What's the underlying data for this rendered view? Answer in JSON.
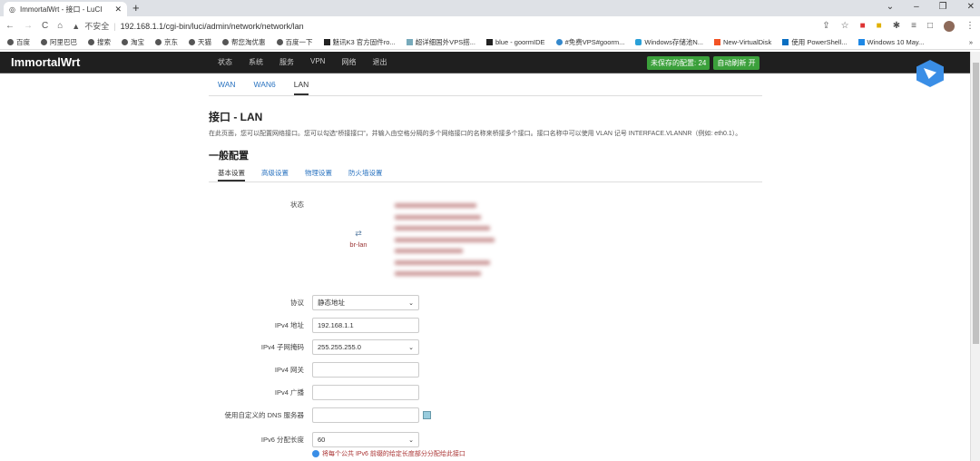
{
  "browser": {
    "tab_title": "ImmortalWrt - 接口 - LuCI",
    "insecure": "不安全",
    "url": "192.168.1.1/cgi-bin/luci/admin/network/network/lan",
    "bookmarks": [
      "百度",
      "阿里巴巴",
      "搜索",
      "淘宝",
      "京东",
      "天猫",
      "帮您淘优惠",
      "百度一下",
      "魅讯K3 官方固件ro...",
      "超详细国外VPS搭...",
      "blue - goormIDE",
      "#免费VPS#goorm...",
      "Windows存储池N...",
      "New-VirtualDisk",
      "使用 PowerShell...",
      "Windows 10 May..."
    ]
  },
  "nav": {
    "brand": "ImmortalWrt",
    "menu": [
      "状态",
      "系统",
      "服务",
      "VPN",
      "网络",
      "退出"
    ],
    "unsaved": "未保存的配置: 24",
    "autorefresh": "自动刷新 开"
  },
  "tabs": [
    "WAN",
    "WAN6",
    "LAN"
  ],
  "page": {
    "title": "接口 - LAN",
    "desc": "在此页面，您可以配置网络接口。您可以勾选“桥接接口”，并输入由空格分隔的多个网络接口的名称来桥接多个接口。接口名称中可以使用 VLAN 记号 INTERFACE.VLANNR（例如: eth0.1）。",
    "section": "一般配置"
  },
  "subtabs": [
    "基本设置",
    "高级设置",
    "物理设置",
    "防火墙设置"
  ],
  "form": {
    "status_label": "状态",
    "iface": "br-lan",
    "protocol_label": "协议",
    "protocol": "静态地址",
    "ipv4_label": "IPv4 地址",
    "ipv4": "192.168.1.1",
    "mask_label": "IPv4 子网掩码",
    "mask": "255.255.255.0",
    "gw_label": "IPv4 网关",
    "bcast_label": "IPv4 广播",
    "dns_label": "使用自定义的 DNS 服务器",
    "ip6len_label": "IPv6 分配长度",
    "ip6len": "60",
    "ip6len_hint": "将每个公共 IPv6 前缀的给定长度部分分配给此接口"
  }
}
